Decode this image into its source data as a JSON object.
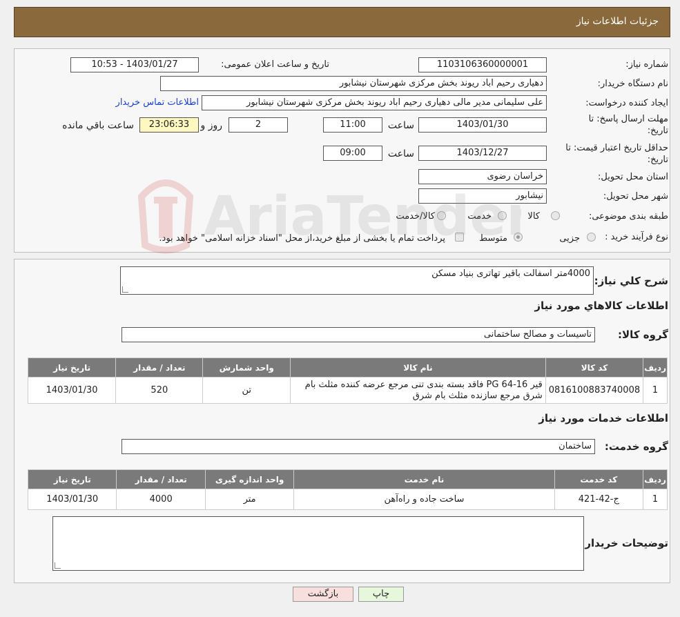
{
  "header": {
    "title": "جزئیات اطلاعات نیاز"
  },
  "info": {
    "need_number_label": "شماره نیاز:",
    "need_number": "1103106360000001",
    "announce_label": "تاریخ و ساعت اعلان عمومی:",
    "announce_value": "1403/01/27 - 10:53",
    "buyer_org_label": "نام دستگاه خریدار:",
    "buyer_org": "دهیاری رحیم اباد ریوند بخش مرکزی شهرستان نیشابور",
    "creator_label": "ایجاد کننده درخواست:",
    "creator": "علی سلیمانی مدیر مالی دهیاری رحیم اباد ریوند بخش مرکزی شهرستان نیشابور",
    "contact_link": "اطلاعات تماس خریدار",
    "deadline_label": "مهلت ارسال پاسخ: تا تاریخ:",
    "deadline_date": "1403/01/30",
    "time_label": "ساعت",
    "deadline_time": "11:00",
    "days_value": "2",
    "days_label": "روز و",
    "remaining_time": "23:06:33",
    "remaining_label": "ساعت باقي مانده",
    "validity_label": "حداقل تاریخ اعتبار قیمت: تا تاریخ:",
    "validity_date": "1403/12/27",
    "validity_time": "09:00",
    "province_label": "استان محل تحویل:",
    "province": "خراسان رضوی",
    "city_label": "شهر محل تحویل:",
    "city": "نیشابور",
    "category_label": "طبقه بندی موضوعی:",
    "category_options": [
      "کالا",
      "خدمت",
      "کالا/خدمت"
    ],
    "process_label": "نوع فرآیند خرید :",
    "process_options": [
      "جزیی",
      "متوسط"
    ],
    "payment_note": "پرداخت تمام یا بخشی از مبلغ خرید،از محل \"اسناد خزانه اسلامی\" خواهد بود."
  },
  "summary": {
    "label": "شرح کلي نياز:",
    "text": "4000متر اسفالت باقیر تهاتری بنیاد مسکن"
  },
  "goods": {
    "title": "اطلاعات کالاهاي مورد نياز",
    "group_label": "گروه کالا:",
    "group_value": "تاسیسات و مصالح ساختمانی",
    "headers": [
      "ردیف",
      "کد کالا",
      "نام کالا",
      "واحد شمارش",
      "تعداد / مقدار",
      "تاریخ نیاز"
    ],
    "rows": [
      [
        "1",
        "0816100883740008",
        "قیر PG 64-16 فاقد بسته بندی تنی مرجع عرضه کننده مثلث بام شرق مرجع سازنده مثلث بام شرق",
        "تن",
        "520",
        "1403/01/30"
      ]
    ]
  },
  "services": {
    "title": "اطلاعات خدمات مورد نياز",
    "group_label": "گروه خدمت:",
    "group_value": "ساختمان",
    "headers": [
      "ردیف",
      "کد خدمت",
      "نام خدمت",
      "واحد اندازه گیری",
      "تعداد / مقدار",
      "تاریخ نیاز"
    ],
    "rows": [
      [
        "1",
        "ج-42-421",
        "ساخت جاده و راه‌آهن",
        "متر",
        "4000",
        "1403/01/30"
      ]
    ]
  },
  "buyer_notes": {
    "label": "توضیحات خریدار:",
    "text": ""
  },
  "buttons": {
    "print": "چاپ",
    "back": "بازگشت"
  },
  "watermark": {
    "text": "AriaTender.neT"
  },
  "colors": {
    "header": "#8a6a3c",
    "link": "#1a3fd1",
    "remaining_bg": "#fff7c0",
    "table_header": "#7a7a7a"
  }
}
